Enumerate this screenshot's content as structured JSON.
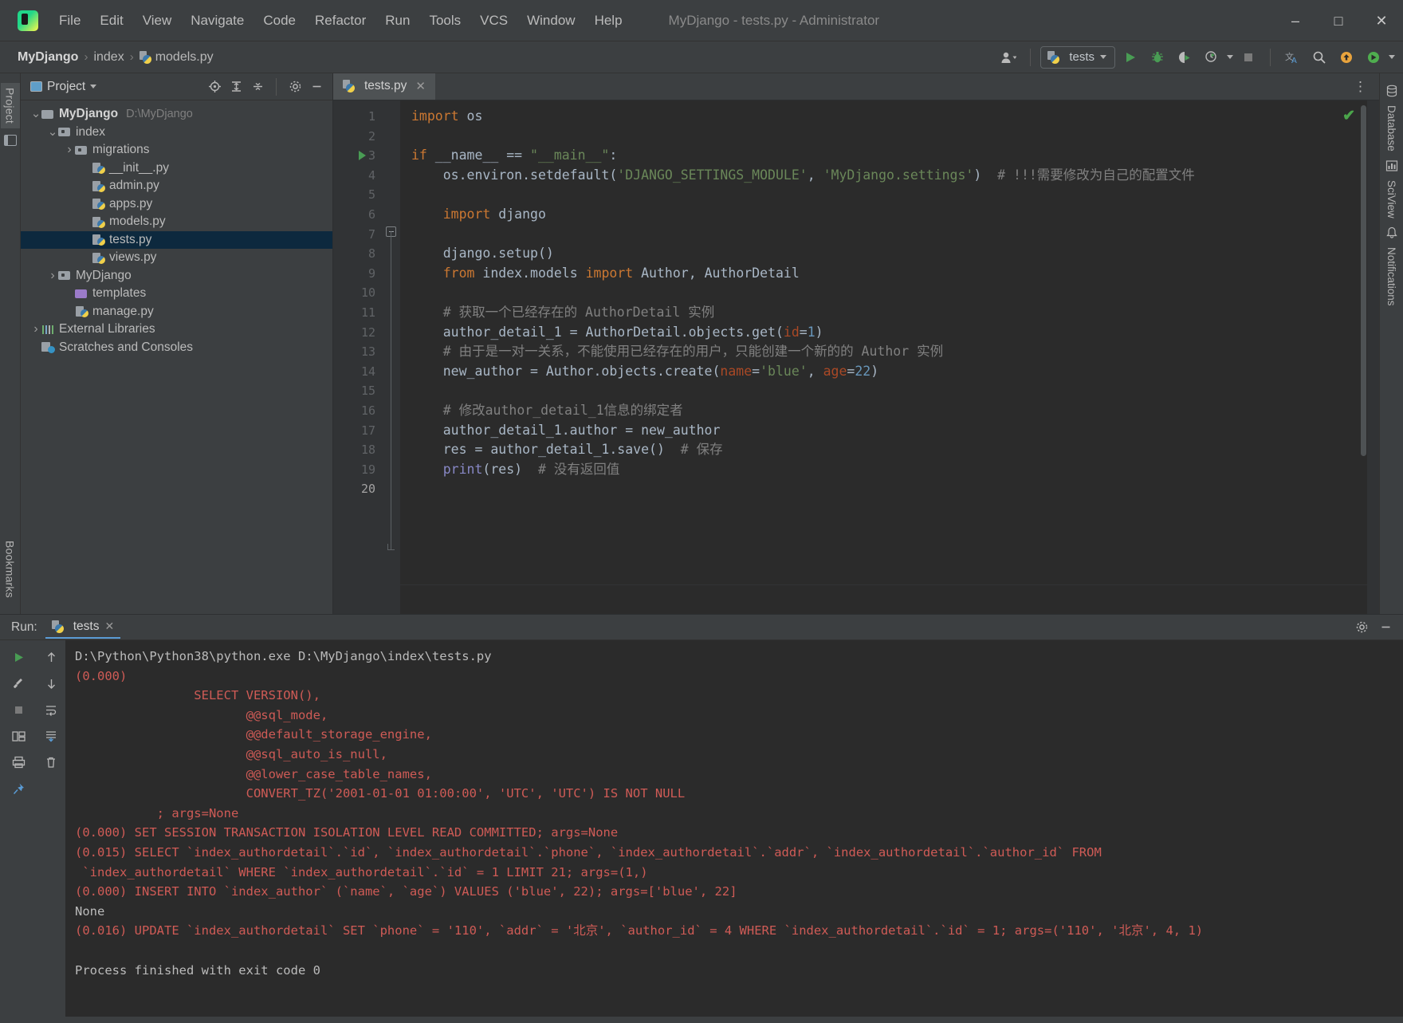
{
  "window": {
    "title": "MyDjango - tests.py - Administrator",
    "logo_icon": "pycharm-logo-icon",
    "minimize_icon": "minimize-icon",
    "maximize_icon": "maximize-icon",
    "close_icon": "close-icon"
  },
  "menubar": {
    "items": [
      "File",
      "Edit",
      "View",
      "Navigate",
      "Code",
      "Refactor",
      "Run",
      "Tools",
      "VCS",
      "Window",
      "Help"
    ]
  },
  "breadcrumb": {
    "project": "MyDjango",
    "sep": "›",
    "package": "index",
    "file": "models.py"
  },
  "toolbar": {
    "user_icon": "user-icon",
    "run_config_label": "tests",
    "run_config_icon": "python-icon",
    "run_icon": "run-icon",
    "debug_icon": "debug-icon",
    "coverage_icon": "coverage-icon",
    "profile_icon": "profile-icon",
    "stop_icon": "stop-icon",
    "translate_icon": "translate-icon",
    "search_icon": "search-icon",
    "update_icon": "update-icon",
    "ide_icon": "ide-icon"
  },
  "left_strip": {
    "project_tab": "Project",
    "bookmarks_tab": "Bookmarks",
    "structure_icon": "structure-icon"
  },
  "right_strip": {
    "items": [
      "Database",
      "SciView",
      "Notifications"
    ]
  },
  "project_panel": {
    "title": "Project",
    "title_icon": "project-window-icon",
    "dropdown_icon": "chevron-down-icon",
    "tools": [
      "locate-icon",
      "expand-all-icon",
      "collapse-all-icon",
      "settings-icon",
      "hide-icon"
    ],
    "tree": [
      {
        "label": "MyDjango",
        "path": "D:\\MyDjango",
        "indent": 0,
        "arrow": "expanded",
        "icon": "folder",
        "bold": true,
        "selected": false
      },
      {
        "label": "index",
        "path": "",
        "indent": 1,
        "arrow": "expanded",
        "icon": "folder-package",
        "bold": false,
        "selected": false
      },
      {
        "label": "migrations",
        "path": "",
        "indent": 2,
        "arrow": "collapsed",
        "icon": "folder-package",
        "bold": false,
        "selected": false
      },
      {
        "label": "__init__.py",
        "path": "",
        "indent": 3,
        "arrow": "none",
        "icon": "python-file",
        "bold": false,
        "selected": false
      },
      {
        "label": "admin.py",
        "path": "",
        "indent": 3,
        "arrow": "none",
        "icon": "python-file",
        "bold": false,
        "selected": false
      },
      {
        "label": "apps.py",
        "path": "",
        "indent": 3,
        "arrow": "none",
        "icon": "python-file",
        "bold": false,
        "selected": false
      },
      {
        "label": "models.py",
        "path": "",
        "indent": 3,
        "arrow": "none",
        "icon": "python-file",
        "bold": false,
        "selected": false
      },
      {
        "label": "tests.py",
        "path": "",
        "indent": 3,
        "arrow": "none",
        "icon": "python-file",
        "bold": false,
        "selected": true
      },
      {
        "label": "views.py",
        "path": "",
        "indent": 3,
        "arrow": "none",
        "icon": "python-file",
        "bold": false,
        "selected": false
      },
      {
        "label": "MyDjango",
        "path": "",
        "indent": 1,
        "arrow": "collapsed",
        "icon": "folder-package",
        "bold": false,
        "selected": false
      },
      {
        "label": "templates",
        "path": "",
        "indent": 2,
        "arrow": "none",
        "icon": "folder-purple",
        "bold": false,
        "selected": false
      },
      {
        "label": "manage.py",
        "path": "",
        "indent": 2,
        "arrow": "none",
        "icon": "python-file",
        "bold": false,
        "selected": false
      },
      {
        "label": "External Libraries",
        "path": "",
        "indent": 0,
        "arrow": "collapsed",
        "icon": "libraries",
        "bold": false,
        "selected": false
      },
      {
        "label": "Scratches and Consoles",
        "path": "",
        "indent": 0,
        "arrow": "none",
        "icon": "scratches",
        "bold": false,
        "selected": false
      }
    ]
  },
  "editor": {
    "tab_label": "tests.py",
    "tab_icon": "python-icon",
    "tab_close_icon": "close-icon",
    "more_icon": "more-options-icon",
    "inspection_status": "✔",
    "total_lines": 20,
    "line_numbers": [
      1,
      2,
      3,
      4,
      5,
      6,
      7,
      8,
      9,
      10,
      11,
      12,
      13,
      14,
      15,
      16,
      17,
      18,
      19,
      20
    ],
    "lines": [
      {
        "n": 1,
        "tokens": [
          {
            "t": "import",
            "c": "kw"
          },
          {
            "t": " os",
            "c": ""
          }
        ]
      },
      {
        "n": 2,
        "tokens": []
      },
      {
        "n": 3,
        "tokens": [
          {
            "t": "if",
            "c": "kw"
          },
          {
            "t": " __name__ == ",
            "c": ""
          },
          {
            "t": "\"__main__\"",
            "c": "str"
          },
          {
            "t": ":",
            "c": ""
          }
        ]
      },
      {
        "n": 4,
        "tokens": [
          {
            "t": "    os.environ.setdefault(",
            "c": ""
          },
          {
            "t": "'DJANGO_SETTINGS_MODULE'",
            "c": "str"
          },
          {
            "t": ", ",
            "c": ""
          },
          {
            "t": "'MyDjango.settings'",
            "c": "str"
          },
          {
            "t": ")  ",
            "c": ""
          },
          {
            "t": "# !!!需要修改为自己的配置文件",
            "c": "cmt"
          }
        ]
      },
      {
        "n": 5,
        "tokens": []
      },
      {
        "n": 6,
        "tokens": [
          {
            "t": "    ",
            "c": ""
          },
          {
            "t": "import",
            "c": "kw"
          },
          {
            "t": " django",
            "c": ""
          }
        ]
      },
      {
        "n": 7,
        "tokens": []
      },
      {
        "n": 8,
        "tokens": [
          {
            "t": "    django.setup()",
            "c": ""
          }
        ]
      },
      {
        "n": 9,
        "tokens": [
          {
            "t": "    ",
            "c": ""
          },
          {
            "t": "from",
            "c": "kw"
          },
          {
            "t": " index.models ",
            "c": ""
          },
          {
            "t": "import",
            "c": "kw"
          },
          {
            "t": " Author, AuthorDetail",
            "c": ""
          }
        ]
      },
      {
        "n": 10,
        "tokens": []
      },
      {
        "n": 11,
        "tokens": [
          {
            "t": "    ",
            "c": ""
          },
          {
            "t": "# 获取一个已经存在的 AuthorDetail 实例",
            "c": "cmt"
          }
        ]
      },
      {
        "n": 12,
        "tokens": [
          {
            "t": "    author_detail_1 = AuthorDetail.objects.get(",
            "c": ""
          },
          {
            "t": "id",
            "c": "kwarg"
          },
          {
            "t": "=",
            "c": ""
          },
          {
            "t": "1",
            "c": "num"
          },
          {
            "t": ")",
            "c": ""
          }
        ]
      },
      {
        "n": 13,
        "tokens": [
          {
            "t": "    ",
            "c": ""
          },
          {
            "t": "# 由于是一对一关系，不能使用已经存在的用户，只能创建一个新的的 Author 实例",
            "c": "cmt"
          }
        ]
      },
      {
        "n": 14,
        "tokens": [
          {
            "t": "    new_author = Author.objects.create(",
            "c": ""
          },
          {
            "t": "name",
            "c": "kwarg"
          },
          {
            "t": "=",
            "c": ""
          },
          {
            "t": "'blue'",
            "c": "str"
          },
          {
            "t": ", ",
            "c": ""
          },
          {
            "t": "age",
            "c": "kwarg"
          },
          {
            "t": "=",
            "c": ""
          },
          {
            "t": "22",
            "c": "num"
          },
          {
            "t": ")",
            "c": ""
          }
        ]
      },
      {
        "n": 15,
        "tokens": []
      },
      {
        "n": 16,
        "tokens": [
          {
            "t": "    ",
            "c": ""
          },
          {
            "t": "# 修改author_detail_1信息的绑定者",
            "c": "cmt"
          }
        ]
      },
      {
        "n": 17,
        "tokens": [
          {
            "t": "    author_detail_1.author = new_author",
            "c": ""
          }
        ]
      },
      {
        "n": 18,
        "tokens": [
          {
            "t": "    res = author_detail_1.save()  ",
            "c": ""
          },
          {
            "t": "# 保存",
            "c": "cmt"
          }
        ]
      },
      {
        "n": 19,
        "tokens": [
          {
            "t": "    ",
            "c": ""
          },
          {
            "t": "print",
            "c": "builtin"
          },
          {
            "t": "(res)  ",
            "c": ""
          },
          {
            "t": "# 没有返回值",
            "c": "cmt"
          }
        ]
      },
      {
        "n": 20,
        "tokens": []
      }
    ]
  },
  "run_panel": {
    "label": "Run:",
    "tab_label": "tests",
    "tab_icon": "python-icon",
    "tab_close_icon": "close-icon",
    "settings_icon": "settings-icon",
    "hide_icon": "hide-icon",
    "side_buttons": [
      "rerun-icon",
      "configure-icon",
      "stop-icon",
      "layout-icon",
      "print-icon",
      "pin-icon"
    ],
    "side_buttons2": [
      "scroll-up-icon",
      "scroll-down-icon",
      "soft-wrap-icon",
      "scroll-to-end-icon",
      "trash-icon"
    ],
    "console_lines": [
      {
        "text": "D:\\Python\\Python38\\python.exe D:\\MyDjango\\index\\tests.py",
        "c": "plain"
      },
      {
        "text": "(0.000)",
        "c": "sql"
      },
      {
        "text": "                SELECT VERSION(),",
        "c": "sql"
      },
      {
        "text": "                       @@sql_mode,",
        "c": "sql"
      },
      {
        "text": "                       @@default_storage_engine,",
        "c": "sql"
      },
      {
        "text": "                       @@sql_auto_is_null,",
        "c": "sql"
      },
      {
        "text": "                       @@lower_case_table_names,",
        "c": "sql"
      },
      {
        "text": "                       CONVERT_TZ('2001-01-01 01:00:00', 'UTC', 'UTC') IS NOT NULL",
        "c": "sql"
      },
      {
        "text": "           ; args=None",
        "c": "sql"
      },
      {
        "text": "(0.000) SET SESSION TRANSACTION ISOLATION LEVEL READ COMMITTED; args=None",
        "c": "sql"
      },
      {
        "text": "(0.015) SELECT `index_authordetail`.`id`, `index_authordetail`.`phone`, `index_authordetail`.`addr`, `index_authordetail`.`author_id` FROM",
        "c": "sql"
      },
      {
        "text": " `index_authordetail` WHERE `index_authordetail`.`id` = 1 LIMIT 21; args=(1,)",
        "c": "sql"
      },
      {
        "text": "(0.000) INSERT INTO `index_author` (`name`, `age`) VALUES ('blue', 22); args=['blue', 22]",
        "c": "sql"
      },
      {
        "text": "None",
        "c": "plain"
      },
      {
        "text": "(0.016) UPDATE `index_authordetail` SET `phone` = '110', `addr` = '北京', `author_id` = 4 WHERE `index_authordetail`.`id` = 1; args=('110', '北京', 4, 1)",
        "c": "sql"
      },
      {
        "text": "",
        "c": "plain"
      },
      {
        "text": "Process finished with exit code 0",
        "c": "plain"
      }
    ]
  }
}
